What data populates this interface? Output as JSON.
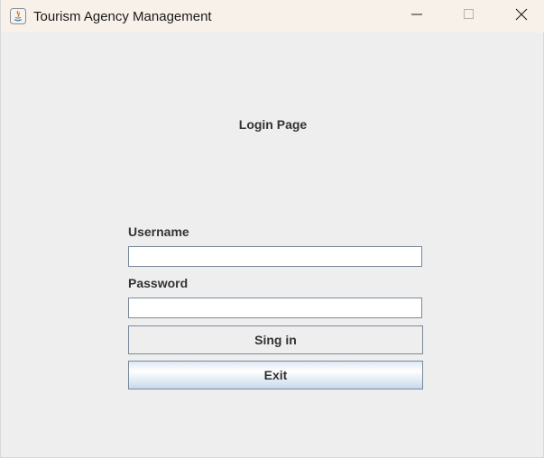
{
  "window": {
    "title": "Tourism Agency Management",
    "icons": {
      "app": "java-app-icon",
      "minimize": "minimize-icon",
      "maximize": "maximize-icon",
      "close": "close-icon"
    }
  },
  "login": {
    "heading": "Login Page",
    "username_label": "Username",
    "username_value": "",
    "password_label": "Password",
    "password_value": "",
    "signin_label": "Sing in",
    "exit_label": "Exit"
  },
  "colors": {
    "titlebar_bg": "#f8f1ea",
    "window_bg": "#eeeeee",
    "text": "#333333",
    "field_border": "#7a8a99"
  }
}
